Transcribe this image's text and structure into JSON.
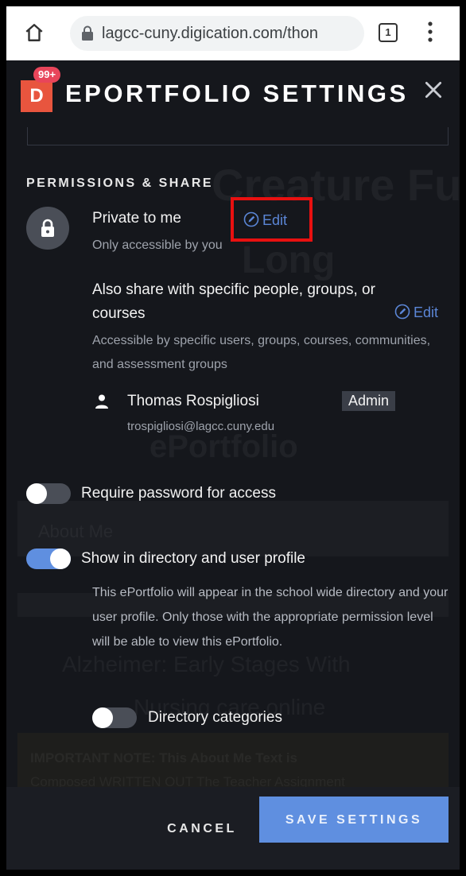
{
  "browser": {
    "url": "lagcc-cuny.digication.com/thon",
    "tab_count": "1"
  },
  "header": {
    "logo_letter": "D",
    "notification_count": "99+",
    "title": "EPORTFOLIO SETTINGS"
  },
  "background_ghost": {
    "line1": "Creature Full",
    "line2": "Long",
    "line3": "ePortfolio",
    "about_me": "About Me",
    "early": "Alzheimer: Early Stages With",
    "online": "Nursing care online",
    "note": "IMPORTANT NOTE: This About Me Text is",
    "note2": "Composed WRITTEN OUT The Teacher Assignment"
  },
  "permissions": {
    "heading": "PERMISSIONS & SHARE",
    "private_label": "Private to me",
    "private_sub": "Only accessible by you",
    "edit_label": "Edit",
    "share_label": "Also share with specific people, groups, or courses",
    "share_sub": "Accessible by specific users, groups, courses, communities, and assessment groups",
    "share_edit_label": "Edit",
    "user": {
      "name": "Thomas Rospigliosi",
      "role": "Admin",
      "email": "trospigliosi@lagcc.cuny.edu"
    }
  },
  "options": {
    "require_password": {
      "label": "Require password for access",
      "enabled": false
    },
    "show_directory": {
      "label": "Show in directory and user profile",
      "enabled": true,
      "description": "This ePortfolio will appear in the school wide directory and your user profile. Only those with the appropriate permission level will be able to view this ePortfolio."
    },
    "directory_categories": {
      "label": "Directory categories",
      "enabled": false
    }
  },
  "footer": {
    "cancel_label": "CANCEL",
    "save_label": "SAVE SETTINGS"
  },
  "colors": {
    "accent": "#5f8fe0",
    "logo": "#e8553e",
    "badge": "#e8455a",
    "highlight": "#e81010",
    "background": "#15171c"
  },
  "icons": [
    "home-icon",
    "lock-icon",
    "close-icon",
    "edit-icon",
    "person-icon",
    "more-vert-icon"
  ]
}
